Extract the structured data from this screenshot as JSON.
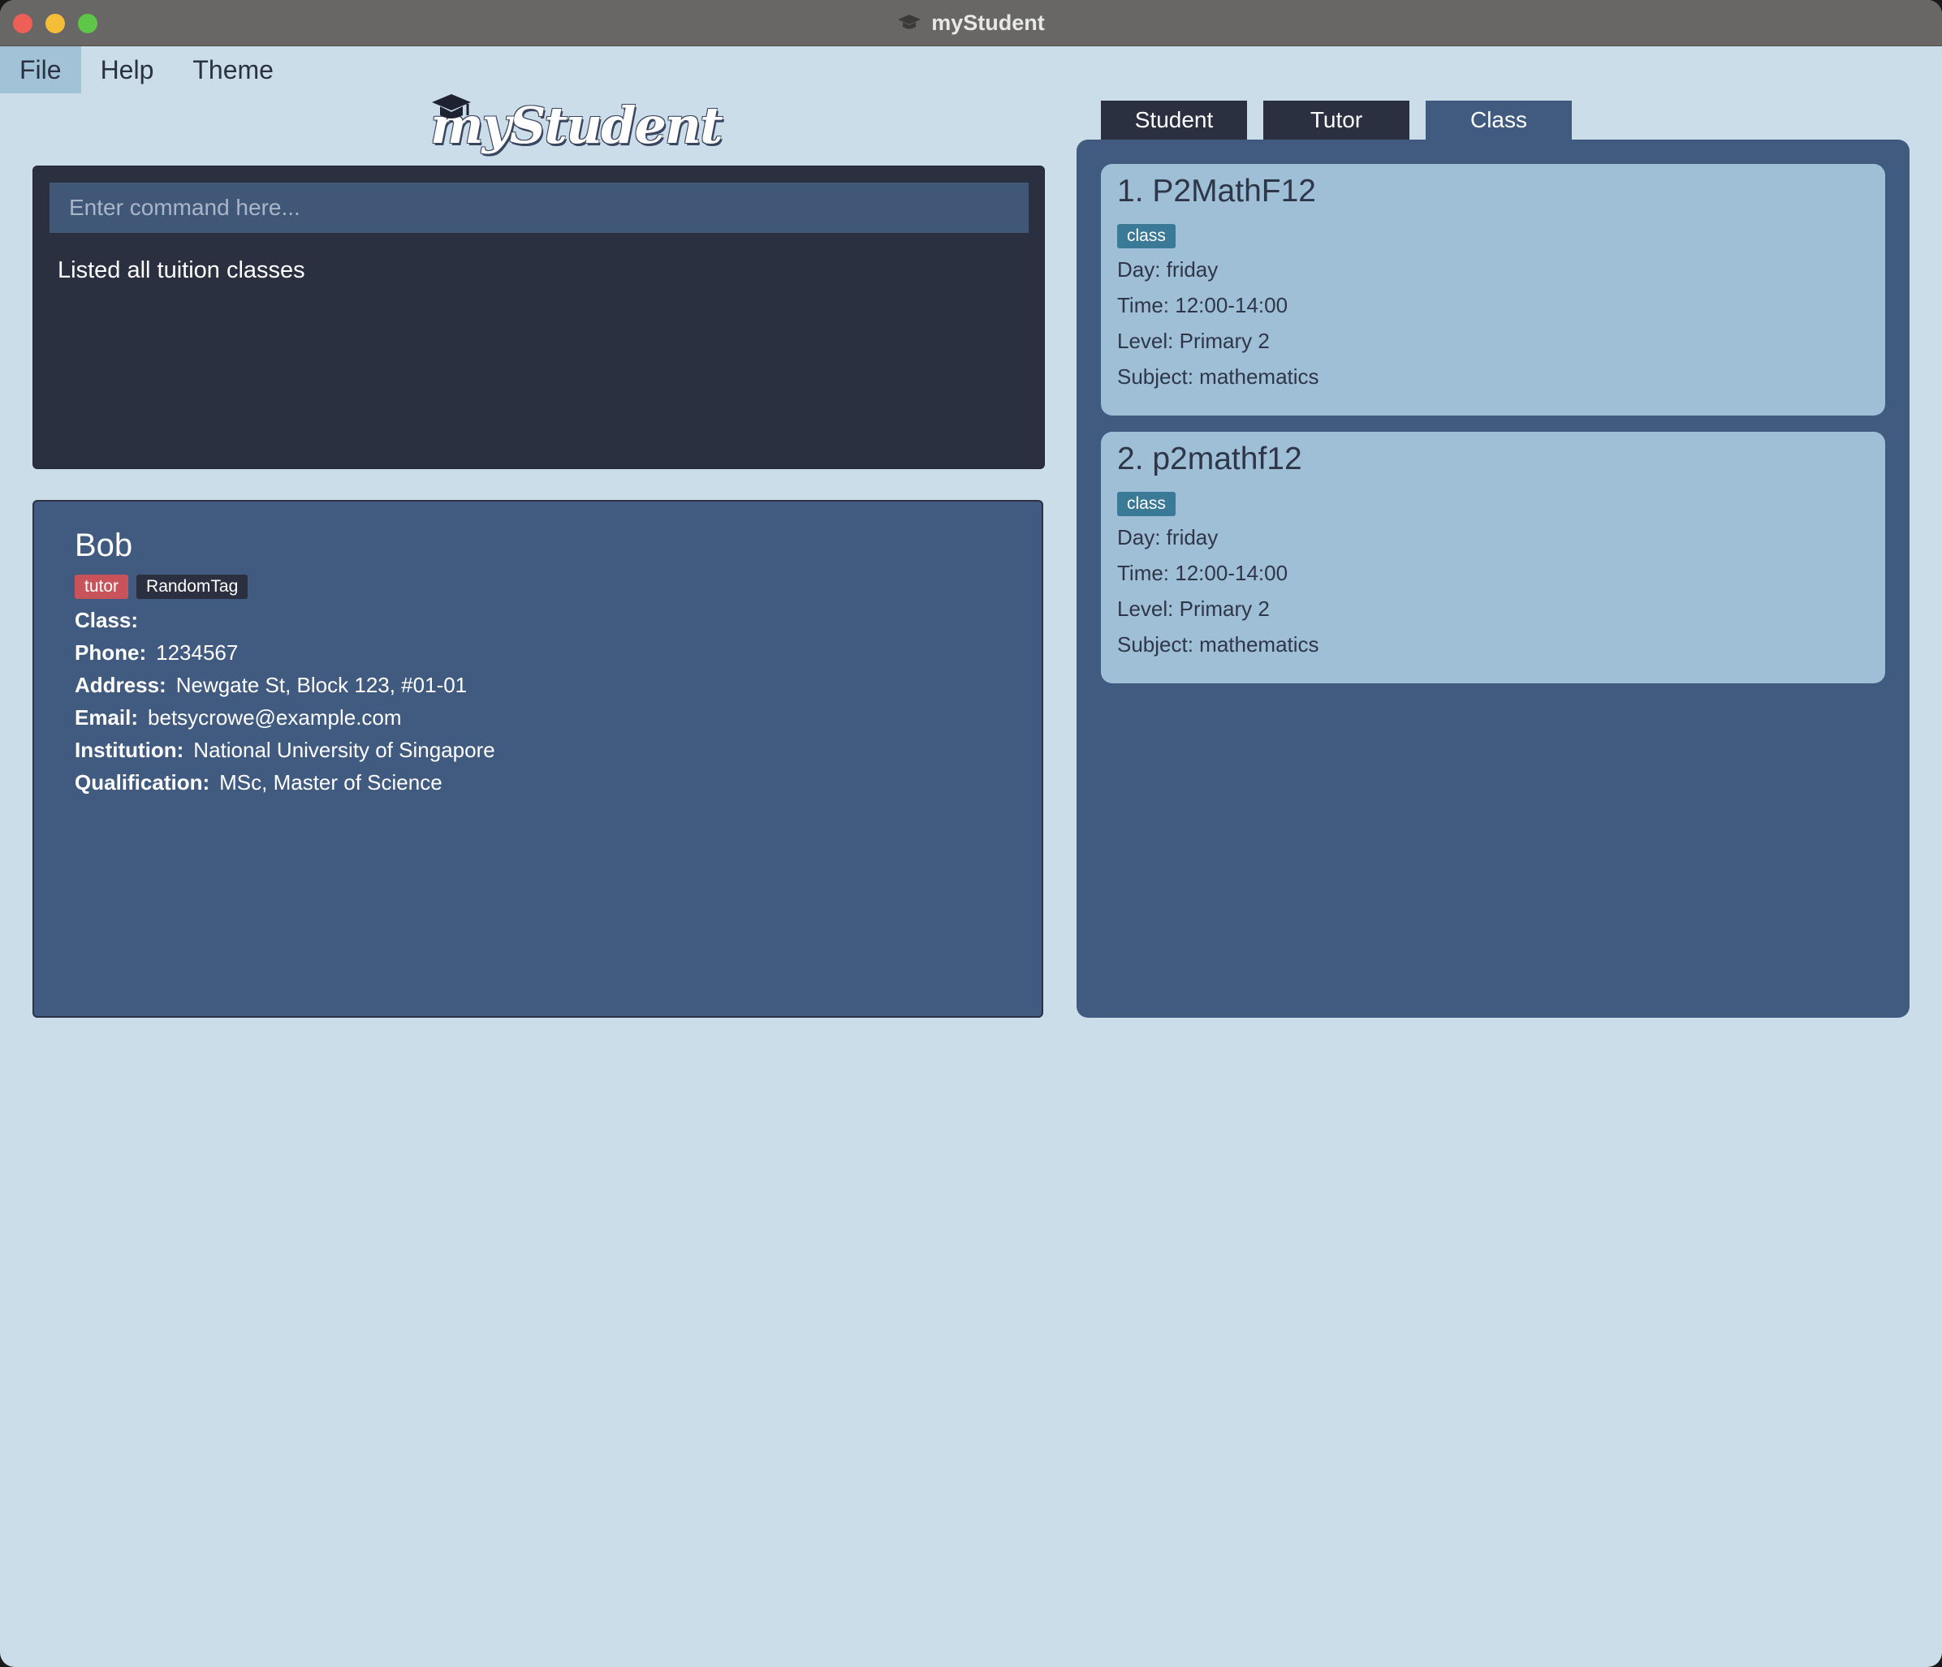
{
  "window": {
    "title": "myStudent"
  },
  "menu": {
    "file": "File",
    "help": "Help",
    "theme": "Theme"
  },
  "logo": {
    "text": "myStudent"
  },
  "command": {
    "placeholder": "Enter command here...",
    "value": "",
    "result": "Listed all tuition classes"
  },
  "detail": {
    "name": "Bob",
    "tags": [
      "tutor",
      "RandomTag"
    ],
    "fields": [
      {
        "label": "Class:",
        "value": ""
      },
      {
        "label": "Phone:",
        "value": "1234567"
      },
      {
        "label": "Address:",
        "value": "Newgate St, Block 123, #01-01"
      },
      {
        "label": "Email:",
        "value": "betsycrowe@example.com"
      },
      {
        "label": "Institution:",
        "value": "National University of Singapore"
      },
      {
        "label": "Qualification:",
        "value": "MSc, Master of Science"
      }
    ]
  },
  "tabs": {
    "student": "Student",
    "tutor": "Tutor",
    "class": "Class",
    "selected": "Class"
  },
  "classes": [
    {
      "title": "1. P2MathF12",
      "tag": "class",
      "day": "Day: friday",
      "time": "Time: 12:00-14:00",
      "level": "Level: Primary 2",
      "subject": "Subject: mathematics"
    },
    {
      "title": "2. p2mathf12",
      "tag": "class",
      "day": "Day: friday",
      "time": "Time: 12:00-14:00",
      "level": "Level: Primary 2",
      "subject": "Subject: mathematics"
    }
  ],
  "colors": {
    "background": "#cbdde9",
    "panel_dark": "#2a3040",
    "panel_blue": "#415a80",
    "card": "#9fbfd6",
    "tutor_tag": "#c9535a",
    "class_tag": "#3a7a96"
  }
}
